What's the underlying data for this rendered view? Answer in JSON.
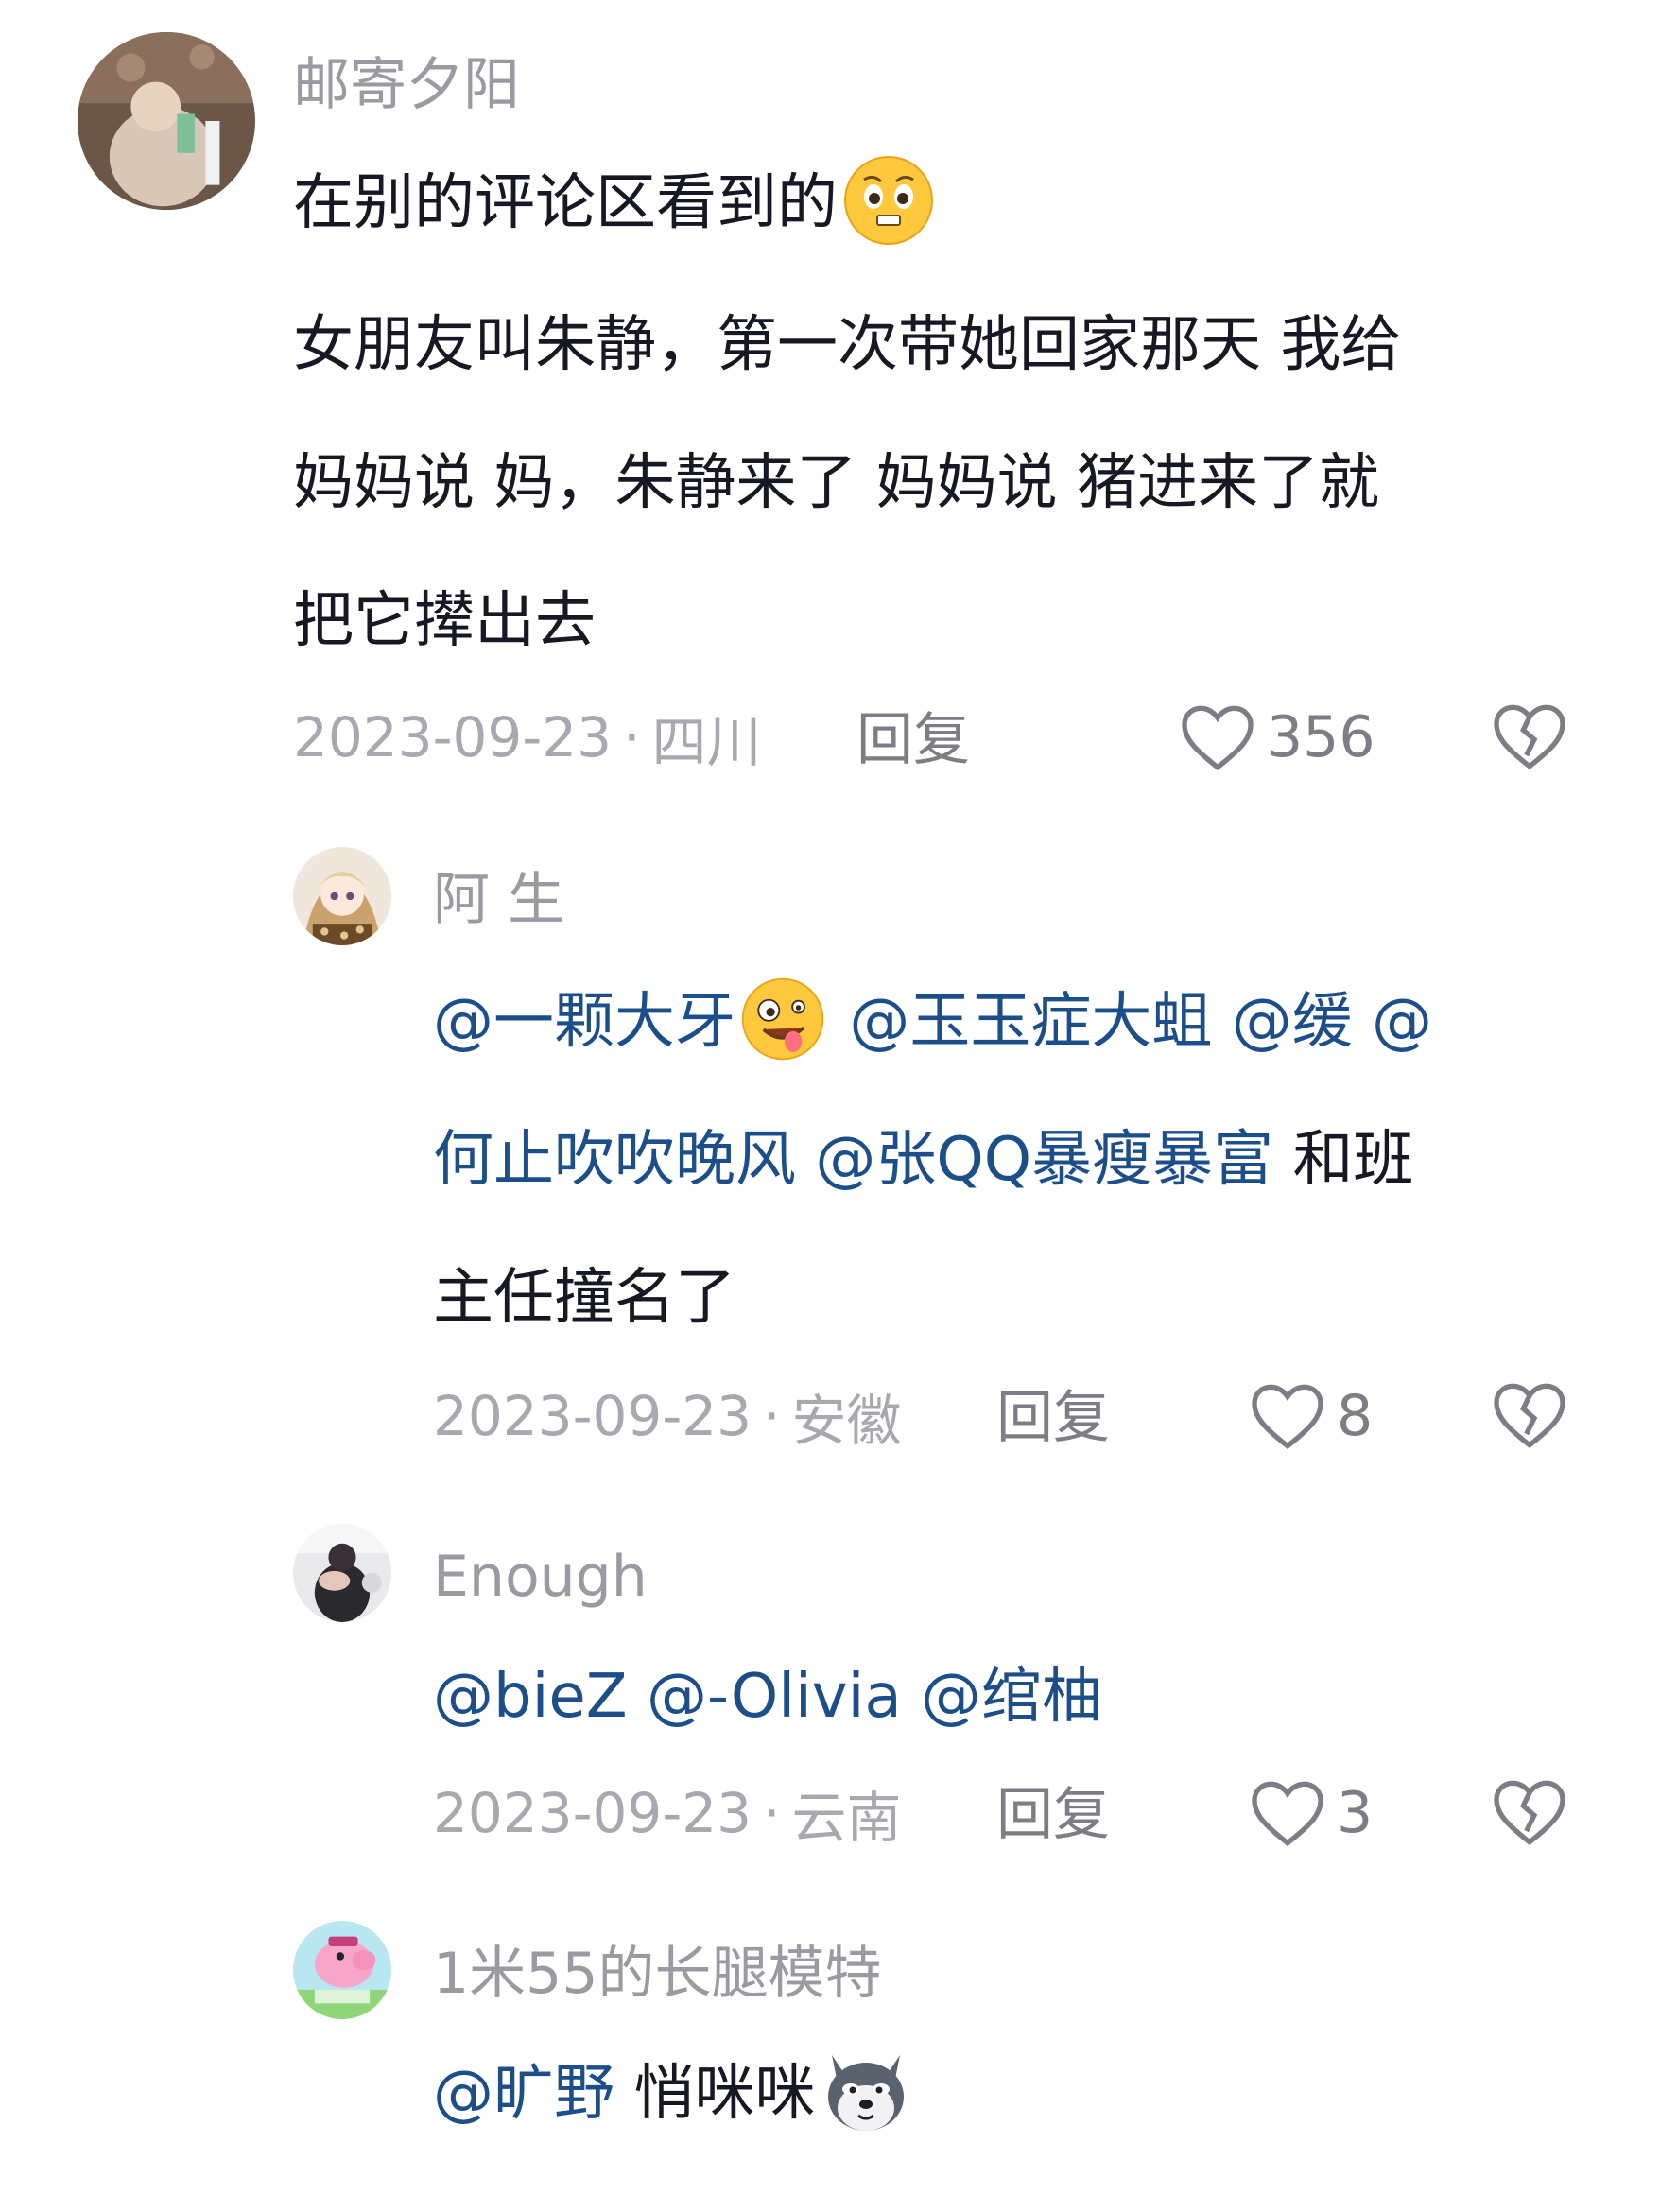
{
  "comments": [
    {
      "username": "邮寄夕阳",
      "lines": [
        "在别的评论区看到的",
        "女朋友叫朱静，第一次带她回家那天 我给",
        "妈妈说 妈，朱静来了 妈妈说 猪进来了就",
        "把它撵出去"
      ],
      "emoji": "pleading-face-emoji",
      "date": "2023-09-23",
      "dot": "·",
      "location": "四川",
      "reply_label": "回复",
      "likes": "356",
      "like_icon": "heart-outline-icon",
      "dislike_icon": "broken-heart-icon"
    }
  ],
  "replies": [
    {
      "username": "阿 生",
      "line1_mentions": [
        "@一颗大牙",
        "@玉玉症大蛆",
        "@缓",
        "@"
      ],
      "line2_mentions": [
        "何止吹吹晚风",
        "@张QQ暴瘦暴富"
      ],
      "line2_text": " 和班",
      "line3_text": "主任撞名了",
      "emoji": "zany-face-emoji",
      "date": "2023-09-23",
      "dot": "·",
      "location": "安徽",
      "reply_label": "回复",
      "likes": "8"
    },
    {
      "username": "Enough",
      "mentions": [
        "@bieZ",
        "@-Olivia",
        "@绾柚"
      ],
      "date": "2023-09-23",
      "dot": "·",
      "location": "云南",
      "reply_label": "回复",
      "likes": "3"
    },
    {
      "username": "1米55的长腿模特",
      "mention": "@旷野",
      "text": " 悄咪咪",
      "emoji": "husky-dog-emoji"
    }
  ],
  "colors": {
    "text": "#161823",
    "username": "#9a9aa2",
    "meta": "#a8a8b0",
    "mention": "#1c4f8a",
    "icon": "#7d7d86"
  }
}
